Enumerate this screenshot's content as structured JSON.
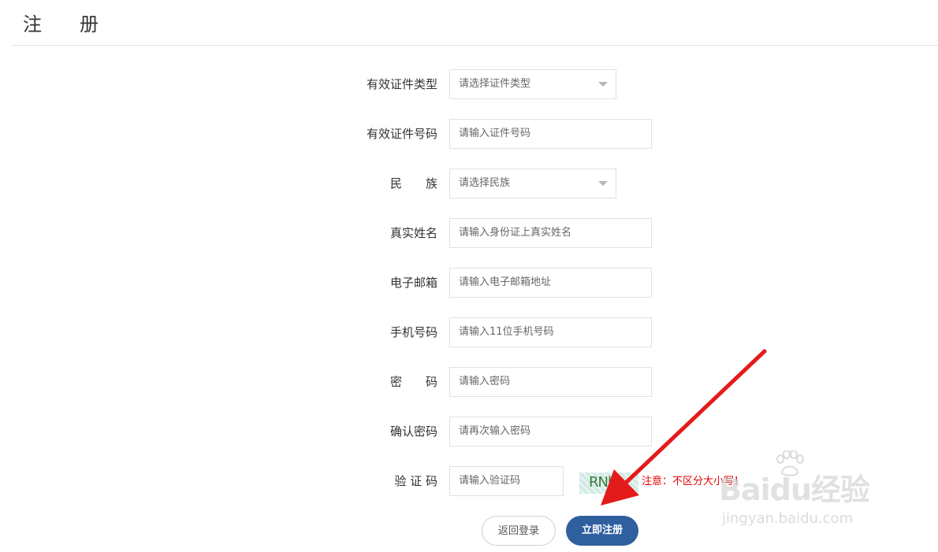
{
  "header": {
    "title": "注　　册"
  },
  "form": {
    "id_type": {
      "label": "有效证件类型",
      "placeholder": "请选择证件类型"
    },
    "id_number": {
      "label": "有效证件号码",
      "placeholder": "请输入证件号码"
    },
    "ethnicity": {
      "label": "民　　族",
      "placeholder": "请选择民族"
    },
    "real_name": {
      "label": "真实姓名",
      "placeholder": "请输入身份证上真实姓名"
    },
    "email": {
      "label": "电子邮箱",
      "placeholder": "请输入电子邮箱地址"
    },
    "phone": {
      "label": "手机号码",
      "placeholder": "请输入11位手机号码"
    },
    "password": {
      "label": "密　　码",
      "placeholder": "请输入密码"
    },
    "confirm_password": {
      "label": "确认密码",
      "placeholder": "请再次输入密码"
    },
    "captcha": {
      "label": "验 证 码",
      "placeholder": "请输入验证码",
      "image_text": "RNb",
      "note": "注意：不区分大小写！"
    }
  },
  "buttons": {
    "back_label": "返回登录",
    "register_label": "立即注册"
  },
  "watermark": {
    "brand": "Baidu经验",
    "url": "jingyan.baidu.com"
  },
  "colors": {
    "primary": "#2f5f9f",
    "note": "#e60000",
    "arrow": "#e41b1b"
  }
}
